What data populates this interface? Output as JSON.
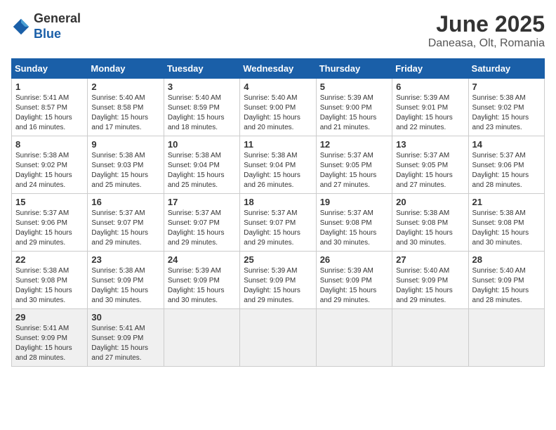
{
  "logo": {
    "general": "General",
    "blue": "Blue"
  },
  "title": "June 2025",
  "subtitle": "Daneasa, Olt, Romania",
  "weekdays": [
    "Sunday",
    "Monday",
    "Tuesday",
    "Wednesday",
    "Thursday",
    "Friday",
    "Saturday"
  ],
  "weeks": [
    [
      {
        "day": "1",
        "sunrise": "5:41 AM",
        "sunset": "8:57 PM",
        "daylight": "15 hours and 16 minutes."
      },
      {
        "day": "2",
        "sunrise": "5:40 AM",
        "sunset": "8:58 PM",
        "daylight": "15 hours and 17 minutes."
      },
      {
        "day": "3",
        "sunrise": "5:40 AM",
        "sunset": "8:59 PM",
        "daylight": "15 hours and 18 minutes."
      },
      {
        "day": "4",
        "sunrise": "5:40 AM",
        "sunset": "9:00 PM",
        "daylight": "15 hours and 20 minutes."
      },
      {
        "day": "5",
        "sunrise": "5:39 AM",
        "sunset": "9:00 PM",
        "daylight": "15 hours and 21 minutes."
      },
      {
        "day": "6",
        "sunrise": "5:39 AM",
        "sunset": "9:01 PM",
        "daylight": "15 hours and 22 minutes."
      },
      {
        "day": "7",
        "sunrise": "5:38 AM",
        "sunset": "9:02 PM",
        "daylight": "15 hours and 23 minutes."
      }
    ],
    [
      {
        "day": "8",
        "sunrise": "5:38 AM",
        "sunset": "9:02 PM",
        "daylight": "15 hours and 24 minutes."
      },
      {
        "day": "9",
        "sunrise": "5:38 AM",
        "sunset": "9:03 PM",
        "daylight": "15 hours and 25 minutes."
      },
      {
        "day": "10",
        "sunrise": "5:38 AM",
        "sunset": "9:04 PM",
        "daylight": "15 hours and 25 minutes."
      },
      {
        "day": "11",
        "sunrise": "5:38 AM",
        "sunset": "9:04 PM",
        "daylight": "15 hours and 26 minutes."
      },
      {
        "day": "12",
        "sunrise": "5:37 AM",
        "sunset": "9:05 PM",
        "daylight": "15 hours and 27 minutes."
      },
      {
        "day": "13",
        "sunrise": "5:37 AM",
        "sunset": "9:05 PM",
        "daylight": "15 hours and 27 minutes."
      },
      {
        "day": "14",
        "sunrise": "5:37 AM",
        "sunset": "9:06 PM",
        "daylight": "15 hours and 28 minutes."
      }
    ],
    [
      {
        "day": "15",
        "sunrise": "5:37 AM",
        "sunset": "9:06 PM",
        "daylight": "15 hours and 29 minutes."
      },
      {
        "day": "16",
        "sunrise": "5:37 AM",
        "sunset": "9:07 PM",
        "daylight": "15 hours and 29 minutes."
      },
      {
        "day": "17",
        "sunrise": "5:37 AM",
        "sunset": "9:07 PM",
        "daylight": "15 hours and 29 minutes."
      },
      {
        "day": "18",
        "sunrise": "5:37 AM",
        "sunset": "9:07 PM",
        "daylight": "15 hours and 29 minutes."
      },
      {
        "day": "19",
        "sunrise": "5:37 AM",
        "sunset": "9:08 PM",
        "daylight": "15 hours and 30 minutes."
      },
      {
        "day": "20",
        "sunrise": "5:38 AM",
        "sunset": "9:08 PM",
        "daylight": "15 hours and 30 minutes."
      },
      {
        "day": "21",
        "sunrise": "5:38 AM",
        "sunset": "9:08 PM",
        "daylight": "15 hours and 30 minutes."
      }
    ],
    [
      {
        "day": "22",
        "sunrise": "5:38 AM",
        "sunset": "9:08 PM",
        "daylight": "15 hours and 30 minutes."
      },
      {
        "day": "23",
        "sunrise": "5:38 AM",
        "sunset": "9:09 PM",
        "daylight": "15 hours and 30 minutes."
      },
      {
        "day": "24",
        "sunrise": "5:39 AM",
        "sunset": "9:09 PM",
        "daylight": "15 hours and 30 minutes."
      },
      {
        "day": "25",
        "sunrise": "5:39 AM",
        "sunset": "9:09 PM",
        "daylight": "15 hours and 29 minutes."
      },
      {
        "day": "26",
        "sunrise": "5:39 AM",
        "sunset": "9:09 PM",
        "daylight": "15 hours and 29 minutes."
      },
      {
        "day": "27",
        "sunrise": "5:40 AM",
        "sunset": "9:09 PM",
        "daylight": "15 hours and 29 minutes."
      },
      {
        "day": "28",
        "sunrise": "5:40 AM",
        "sunset": "9:09 PM",
        "daylight": "15 hours and 28 minutes."
      }
    ],
    [
      {
        "day": "29",
        "sunrise": "5:41 AM",
        "sunset": "9:09 PM",
        "daylight": "15 hours and 28 minutes."
      },
      {
        "day": "30",
        "sunrise": "5:41 AM",
        "sunset": "9:09 PM",
        "daylight": "15 hours and 27 minutes."
      },
      null,
      null,
      null,
      null,
      null
    ]
  ]
}
